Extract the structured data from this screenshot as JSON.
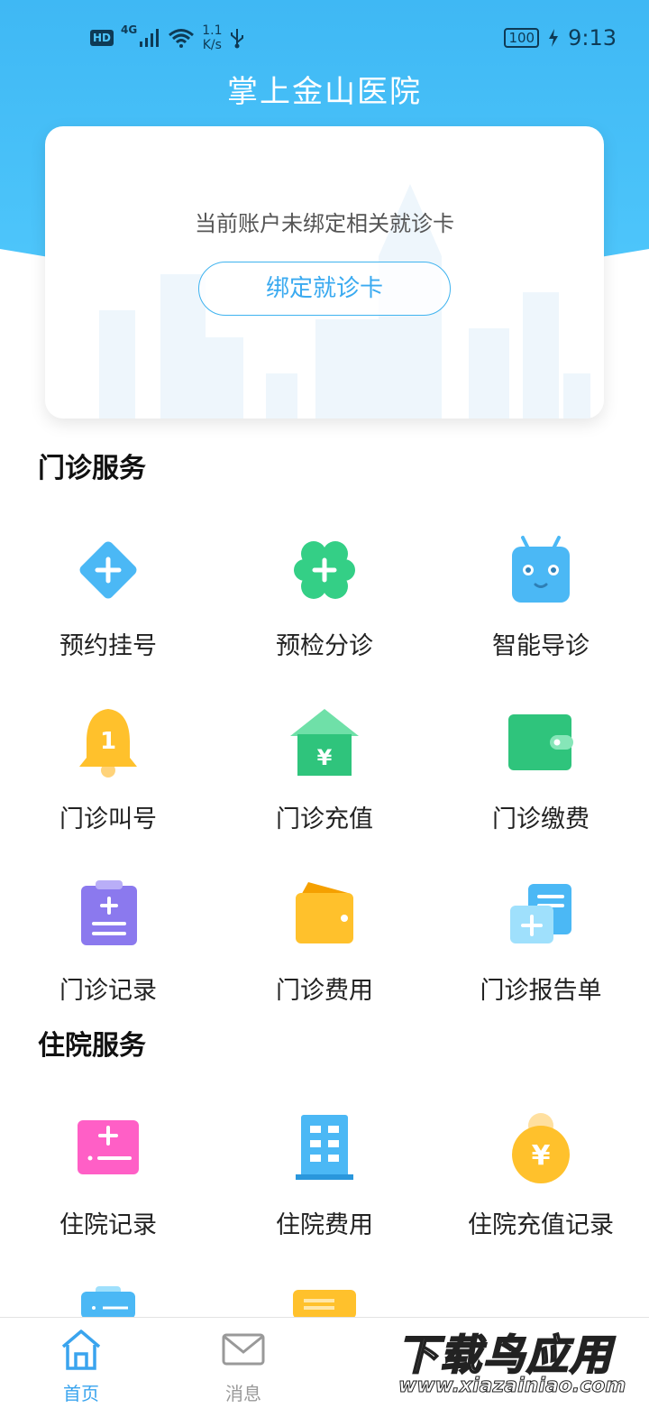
{
  "status_bar": {
    "hd": "HD",
    "network": "4G",
    "speed_value": "1.1",
    "speed_unit": "K/s",
    "battery": "100",
    "time": "9:13"
  },
  "app_title": "掌上金山医院",
  "card": {
    "message": "当前账户未绑定相关就诊卡",
    "bind_button": "绑定就诊卡"
  },
  "outpatient": {
    "title": "门诊服务",
    "items": [
      {
        "label": "预约挂号",
        "icon": "diamond-plus-icon"
      },
      {
        "label": "预检分诊",
        "icon": "clover-plus-icon"
      },
      {
        "label": "智能导诊",
        "icon": "robot-icon"
      },
      {
        "label": "门诊叫号",
        "icon": "bell-icon"
      },
      {
        "label": "门诊充值",
        "icon": "house-yuan-icon"
      },
      {
        "label": "门诊缴费",
        "icon": "wallet-icon"
      },
      {
        "label": "门诊记录",
        "icon": "clipboard-icon"
      },
      {
        "label": "门诊费用",
        "icon": "purse-icon"
      },
      {
        "label": "门诊报告单",
        "icon": "report-icon"
      }
    ]
  },
  "inpatient": {
    "title": "住院服务",
    "items": [
      {
        "label": "住院记录",
        "icon": "calculator-icon"
      },
      {
        "label": "住院费用",
        "icon": "building-icon"
      },
      {
        "label": "住院充值记录",
        "icon": "coin-bag-icon"
      }
    ]
  },
  "bottom_nav": {
    "items": [
      {
        "label": "首页",
        "icon": "home-icon",
        "active": true
      },
      {
        "label": "消息",
        "icon": "mail-icon",
        "active": false
      }
    ]
  },
  "watermark": {
    "text": "下载鸟应用",
    "url": "www.xiazainiao.com"
  },
  "colors": {
    "header": "#4ec6fb",
    "accent": "#3aa4ee"
  }
}
